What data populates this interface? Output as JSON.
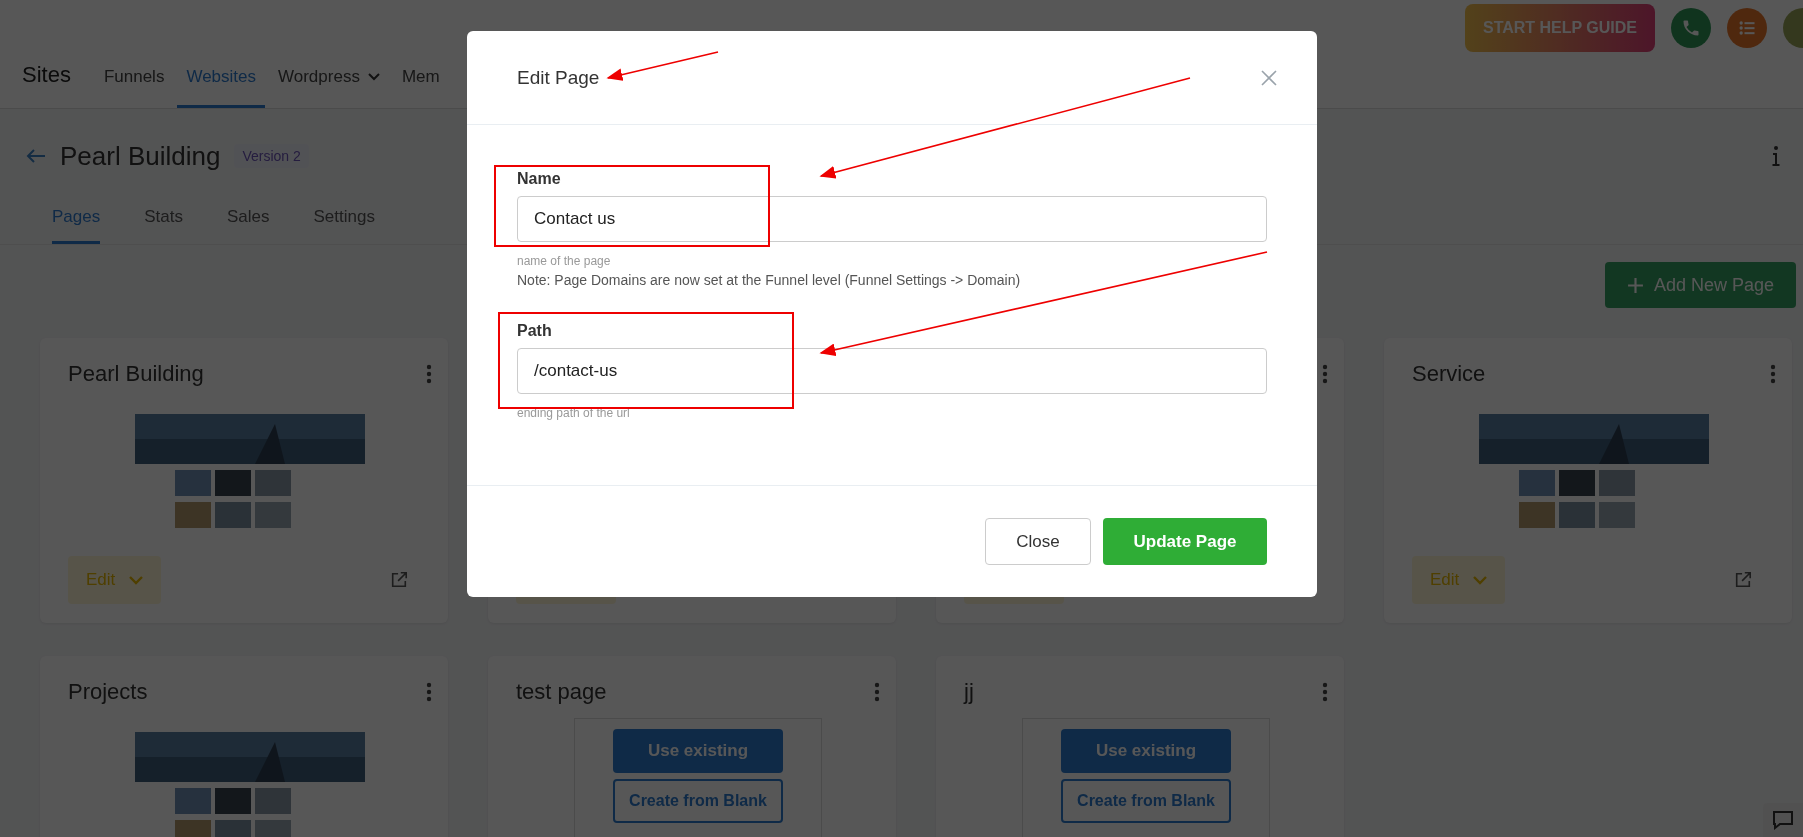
{
  "header": {
    "title": "Sites",
    "help_button": "START HELP GUIDE",
    "nav": [
      {
        "label": "Funnels",
        "selected": false,
        "dropdown": false
      },
      {
        "label": "Websites",
        "selected": true,
        "dropdown": false
      },
      {
        "label": "Wordpress",
        "selected": false,
        "dropdown": true
      },
      {
        "label": "Mem",
        "selected": false,
        "dropdown": false
      }
    ]
  },
  "site": {
    "title": "Pearl Building",
    "badge": "Version 2",
    "tabs": [
      {
        "label": "Pages",
        "selected": true
      },
      {
        "label": "Stats",
        "selected": false
      },
      {
        "label": "Sales",
        "selected": false
      },
      {
        "label": "Settings",
        "selected": false
      }
    ]
  },
  "add_button": "Add New Page",
  "cards": [
    {
      "kind": "preview",
      "title": "Pearl Building",
      "edit": "Edit"
    },
    {
      "kind": "covered"
    },
    {
      "kind": "partial"
    },
    {
      "kind": "preview",
      "title": "Service",
      "edit": "Edit"
    },
    {
      "kind": "preview",
      "title": "Projects"
    },
    {
      "kind": "blank",
      "title": "test page",
      "use_button": "Use existing",
      "create_button": "Create from Blank"
    },
    {
      "kind": "blank",
      "title": "jj",
      "use_button": "Use existing",
      "create_button": "Create from Blank"
    }
  ],
  "modal": {
    "title": "Edit Page",
    "fields": [
      {
        "label": "Name",
        "value": "Contact us",
        "hint": "name of the page",
        "note": "Note: Page Domains are now set at the Funnel level (Funnel Settings -> Domain)"
      },
      {
        "label": "Path",
        "value": "/contact-us",
        "hint": "ending path of the url"
      }
    ],
    "buttons": [
      {
        "kind": "secondary",
        "label": "Close"
      },
      {
        "kind": "primary",
        "label": "Update Page"
      }
    ]
  }
}
